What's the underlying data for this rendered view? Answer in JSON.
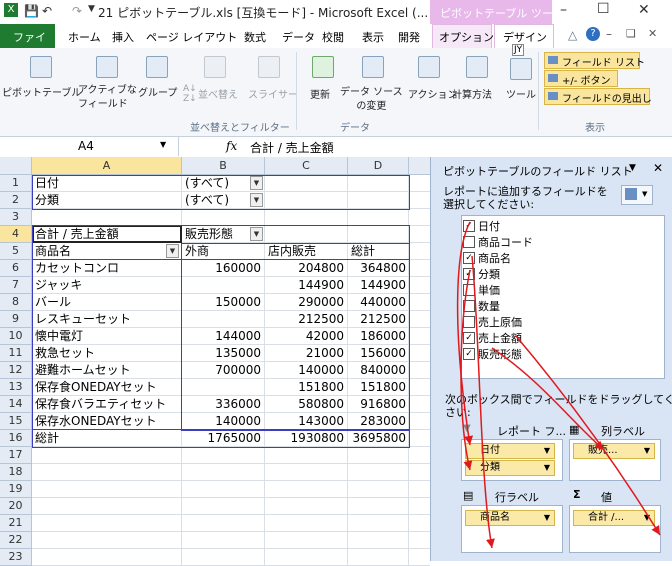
{
  "titlebar": {
    "title": "21 ピボットテーブル.xls  [互換モード] - Microsoft Excel (...",
    "context_tab_group": "ピボットテーブル ツール"
  },
  "tabs": {
    "file": "ファイル",
    "items": [
      "ホーム",
      "挿入",
      "ページ レイアウト",
      "数式",
      "データ",
      "校閲",
      "表示",
      "開発"
    ],
    "options": "オプション",
    "design": "デザイン",
    "keytip": "JY"
  },
  "ribbon": {
    "pivot_table": "ピボットテーブル",
    "active_field": "アクティブな\nフィールド",
    "group": "グループ",
    "sort": "並べ替え",
    "slicer": "スライサー",
    "refresh": "更新",
    "data_source": "データ ソース\nの変更",
    "action": "アクション",
    "calc": "計算方法",
    "tools": "ツール",
    "field_list": "フィールド リスト",
    "plusminus": "+/- ボタン",
    "field_headers": "フィールドの見出し",
    "group_sort_filter": "並べ替えとフィルター",
    "group_data": "データ",
    "group_show": "表示"
  },
  "formula_bar": {
    "name_box": "A4",
    "fx": "fx",
    "content": "合計 / 売上金額"
  },
  "sheet": {
    "columns": [
      "A",
      "B",
      "C",
      "D"
    ],
    "rows": [
      "1",
      "2",
      "3",
      "4",
      "5",
      "6",
      "7",
      "8",
      "9",
      "10",
      "11",
      "12",
      "13",
      "14",
      "15",
      "16",
      "17",
      "18",
      "19",
      "20",
      "21",
      "22",
      "23"
    ],
    "filter1_label": "日付",
    "filter1_value": "(すべて)",
    "filter2_label": "分類",
    "filter2_value": "(すべて)",
    "a4": "合計 / 売上金額",
    "b4": "販売形態",
    "a5": "商品名",
    "b5": "外商",
    "c5": "店内販売",
    "d5": "総計",
    "data_rows": [
      {
        "name": "カセットコンロ",
        "b": "160000",
        "c": "204800",
        "d": "364800"
      },
      {
        "name": "ジャッキ",
        "b": "",
        "c": "144900",
        "d": "144900"
      },
      {
        "name": "バール",
        "b": "150000",
        "c": "290000",
        "d": "440000"
      },
      {
        "name": "レスキューセット",
        "b": "",
        "c": "212500",
        "d": "212500"
      },
      {
        "name": "懐中電灯",
        "b": "144000",
        "c": "42000",
        "d": "186000"
      },
      {
        "name": "救急セット",
        "b": "135000",
        "c": "21000",
        "d": "156000"
      },
      {
        "name": "避難ホームセット",
        "b": "700000",
        "c": "140000",
        "d": "840000"
      },
      {
        "name": "保存食ONEDAYセット",
        "b": "",
        "c": "151800",
        "d": "151800"
      },
      {
        "name": "保存食バラエティセット",
        "b": "336000",
        "c": "580800",
        "d": "916800"
      },
      {
        "name": "保存水ONEDAYセット",
        "b": "140000",
        "c": "143000",
        "d": "283000"
      }
    ],
    "total_label": "総計",
    "total_b": "1765000",
    "total_c": "1930800",
    "total_d": "3695800"
  },
  "field_list": {
    "title": "ピボットテーブルのフィールド リスト",
    "instruction": "レポートに追加するフィールドを\n選択してください:",
    "fields": [
      {
        "label": "日付",
        "checked": true
      },
      {
        "label": "商品コード",
        "checked": false
      },
      {
        "label": "商品名",
        "checked": true
      },
      {
        "label": "分類",
        "checked": true
      },
      {
        "label": "単価",
        "checked": false
      },
      {
        "label": "数量",
        "checked": false
      },
      {
        "label": "売上原価",
        "checked": false
      },
      {
        "label": "売上金額",
        "checked": true
      },
      {
        "label": "販売形態",
        "checked": true
      }
    ],
    "drag_hint": "次のボックス間でフィールドをドラッグしてくだ\nさい:",
    "report_filter": "レポート フ...",
    "column_labels": "列ラベル",
    "row_labels": "行ラベル",
    "values": "値",
    "filter_items": [
      "日付",
      "分類"
    ],
    "column_items": [
      "販売..."
    ],
    "row_items": [
      "商品名"
    ],
    "value_items": [
      "合計 /..."
    ]
  },
  "colors": {
    "file_tab": "#1e7b2f",
    "context_tab": "#e7b8e9",
    "arrow": "#e0191d",
    "pivot_border": "#3d3dbf"
  }
}
